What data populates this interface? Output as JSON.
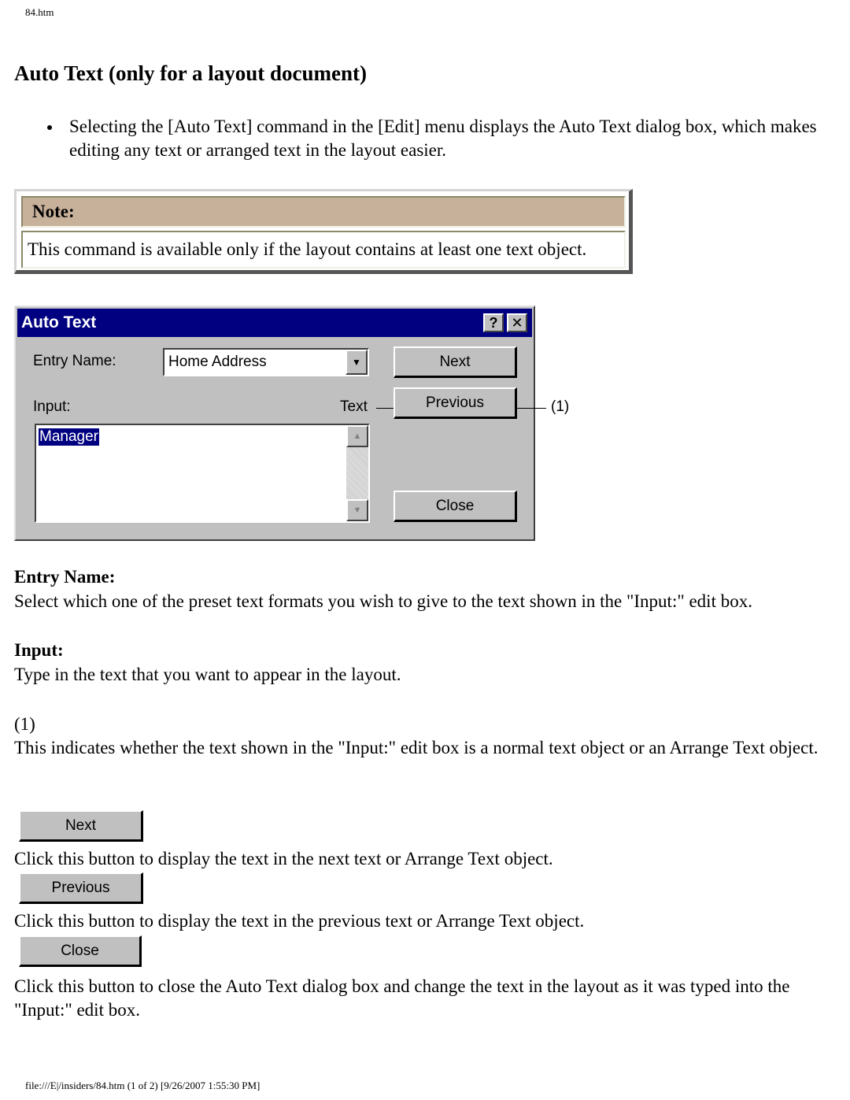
{
  "header": {
    "file_name": "84.htm"
  },
  "page_title": "Auto Text (only for a layout document)",
  "bullets": [
    "Selecting the [Auto Text] command in the [Edit] menu displays the Auto Text dialog box, which makes editing any text or arranged text in the layout easier."
  ],
  "note": {
    "heading": "Note:",
    "body": "This command is available only if the layout contains at least one text object."
  },
  "dialog": {
    "title": "Auto Text",
    "help_button": "?",
    "close_button": "✕",
    "entry_name_label": "Entry Name:",
    "entry_name_value": "Home Address",
    "input_label": "Input:",
    "text_type_label": "Text",
    "input_value": "Manager",
    "callout": "(1)",
    "next_button": "Next",
    "previous_button": "Previous",
    "close_label": "Close",
    "icons": {
      "dropdown": "▼",
      "scroll_up": "▲",
      "scroll_down": "▼"
    }
  },
  "sections": [
    {
      "title": "Entry Name:",
      "text": "Select which one of the preset text formats you wish to give to the text shown in the \"Input:\" edit box."
    },
    {
      "title": "Input:",
      "text": "Type in the text that you want to appear in the layout."
    },
    {
      "title": "(1)",
      "text": "This indicates whether the text shown in the \"Input:\" edit box is a normal text object or an Arrange Text object."
    }
  ],
  "buttons_help": [
    {
      "button": "Next",
      "text": "Click this button to display the text in the next text or Arrange Text object."
    },
    {
      "button": "Previous",
      "text": "Click this button to display the text in the previous text or Arrange Text object."
    },
    {
      "button": "Close",
      "text": "Click this button to close the Auto Text dialog box and change the text in the layout as it was typed into the \"Input:\" edit box."
    }
  ],
  "footer": {
    "text": "file:///E|/insiders/84.htm (1 of 2) [9/26/2007 1:55:30 PM]"
  }
}
